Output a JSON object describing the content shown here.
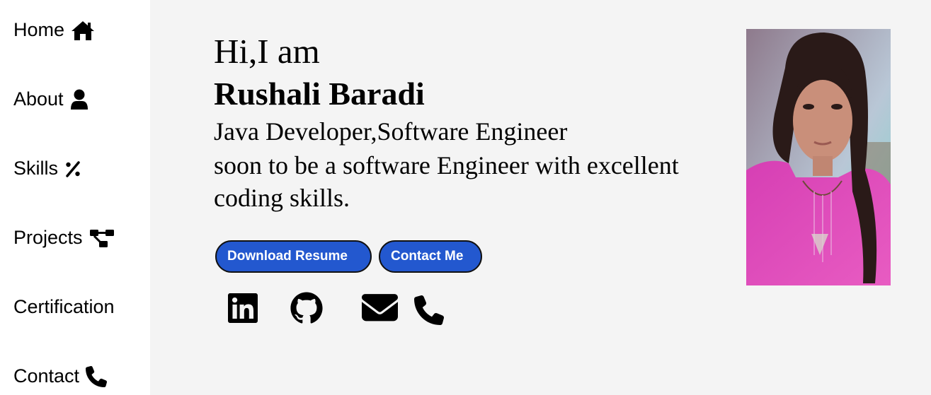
{
  "nav": {
    "items": [
      {
        "label": "Home",
        "icon": "home-icon"
      },
      {
        "label": "About",
        "icon": "user-icon"
      },
      {
        "label": "Skills",
        "icon": "percent-icon"
      },
      {
        "label": "Projects",
        "icon": "sitemap-icon"
      },
      {
        "label": "Certification",
        "icon": ""
      },
      {
        "label": "Contact",
        "icon": "phone-icon"
      }
    ]
  },
  "hero": {
    "greeting": "Hi,I am",
    "name": "Rushali Baradi",
    "role": "Java Developer,Software Engineer",
    "tagline": "soon to be a software Engineer with excellent coding skills.",
    "buttons": {
      "download": "Download Resume",
      "contact": "Contact Me"
    },
    "button_color": "#2358cf",
    "socials": [
      "linkedin-icon",
      "github-icon",
      "email-icon",
      "phone-icon"
    ]
  }
}
